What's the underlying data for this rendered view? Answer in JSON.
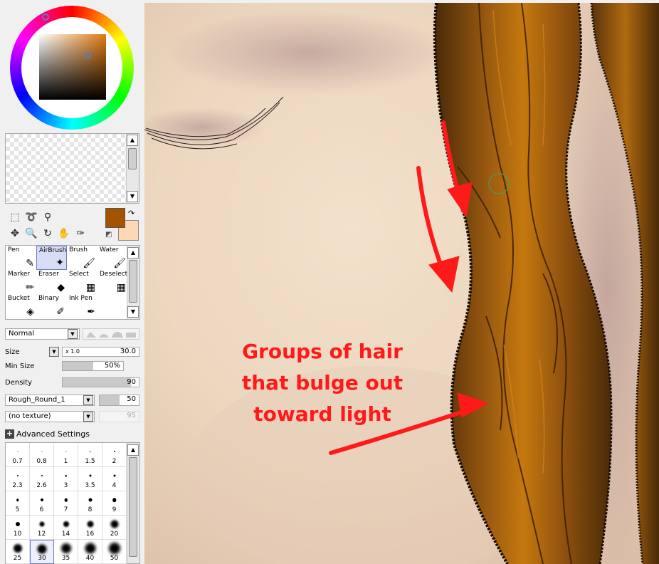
{
  "brush_tools": [
    {
      "label": "Pen",
      "icon": "✎",
      "selected": false
    },
    {
      "label": "AirBrush",
      "icon": "✦",
      "selected": true
    },
    {
      "label": "Brush",
      "icon": "🖌",
      "selected": false
    },
    {
      "label": "Water",
      "icon": "🖌",
      "selected": false
    },
    {
      "label": "Marker",
      "icon": "✏",
      "selected": false
    },
    {
      "label": "Eraser",
      "icon": "◆",
      "selected": false
    },
    {
      "label": "Select",
      "icon": "▦",
      "selected": false
    },
    {
      "label": "Deselect",
      "icon": "▦",
      "selected": false
    },
    {
      "label": "Bucket",
      "icon": "◈",
      "selected": false
    },
    {
      "label": "Binary",
      "icon": "✐",
      "selected": false
    },
    {
      "label": "Ink Pen",
      "icon": "✒",
      "selected": false
    }
  ],
  "blend": {
    "mode": "Normal"
  },
  "size": {
    "label": "Size",
    "multiplier": "x 1.0",
    "value": "30.0"
  },
  "min_size": {
    "label": "Min Size",
    "value": "50%",
    "fraction": 0.5
  },
  "density": {
    "label": "Density",
    "value": "90",
    "fraction": 0.9
  },
  "brush_shape": {
    "value": "Rough_Round_1",
    "strength": "50",
    "strength_fraction": 0.5
  },
  "texture": {
    "value": "(no texture)",
    "strength": "95"
  },
  "advanced": {
    "label": "Advanced Settings"
  },
  "brush_sizes": [
    {
      "label": "0.7",
      "dot": 1
    },
    {
      "label": "0.8",
      "dot": 1
    },
    {
      "label": "1",
      "dot": 1
    },
    {
      "label": "1.5",
      "dot": 1.5
    },
    {
      "label": "2",
      "dot": 2
    },
    {
      "label": "2.3",
      "dot": 2
    },
    {
      "label": "2.6",
      "dot": 2
    },
    {
      "label": "3",
      "dot": 2.5
    },
    {
      "label": "3.5",
      "dot": 3
    },
    {
      "label": "4",
      "dot": 3
    },
    {
      "label": "5",
      "dot": 3.5
    },
    {
      "label": "6",
      "dot": 4
    },
    {
      "label": "7",
      "dot": 4.5
    },
    {
      "label": "8",
      "dot": 5
    },
    {
      "label": "9",
      "dot": 5.5
    },
    {
      "label": "10",
      "dot": 6
    },
    {
      "label": "12",
      "dot": 7
    },
    {
      "label": "14",
      "dot": 8
    },
    {
      "label": "16",
      "dot": 9
    },
    {
      "label": "20",
      "dot": 11
    },
    {
      "label": "25",
      "dot": 12
    },
    {
      "label": "30",
      "dot": 13,
      "selected": true
    },
    {
      "label": "35",
      "dot": 14
    },
    {
      "label": "40",
      "dot": 15
    },
    {
      "label": "50",
      "dot": 16
    }
  ],
  "colors": {
    "primary": "#a45400",
    "secondary": "#fcd8b4",
    "annotation": "#ff1a1a"
  },
  "canvas": {
    "annotation_lines": [
      "Groups of hair",
      "that bulge out",
      "toward light"
    ]
  }
}
